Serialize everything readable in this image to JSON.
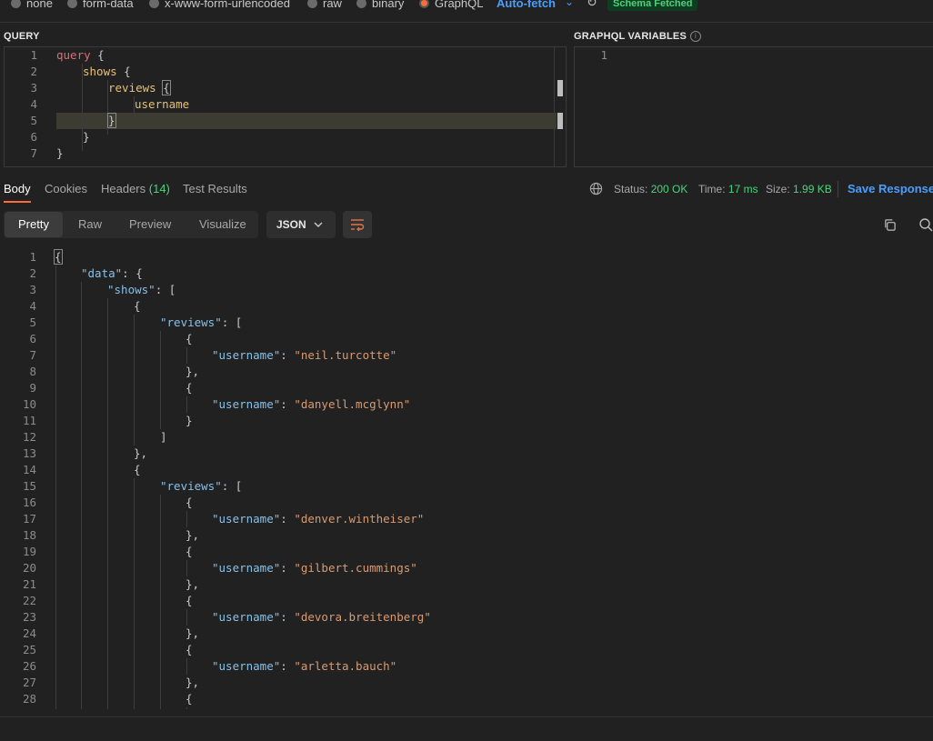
{
  "body_types": [
    {
      "label": "none",
      "selected": false
    },
    {
      "label": "form-data",
      "selected": false
    },
    {
      "label": "x-www-form-urlencoded",
      "selected": false
    },
    {
      "label": "raw",
      "selected": false
    },
    {
      "label": "binary",
      "selected": false
    },
    {
      "label": "GraphQL",
      "selected": true
    }
  ],
  "auto_fetch": "Auto-fetch",
  "schema_status": "Schema Fetched",
  "query_label": "QUERY",
  "variables_label": "GRAPHQL VARIABLES",
  "query_lines": [
    "1",
    "2",
    "3",
    "4",
    "5",
    "6",
    "7"
  ],
  "query": {
    "kw": "query",
    "shows": "shows",
    "reviews": "reviews",
    "username": "username",
    "open": "{",
    "close": "}"
  },
  "variables_lines": [
    "1"
  ],
  "response_tabs": {
    "body": "Body",
    "cookies": "Cookies",
    "headers": "Headers",
    "headers_count": "(14)",
    "tests": "Test Results"
  },
  "response_meta": {
    "status_label": "Status:",
    "status_value": "200 OK",
    "time_label": "Time:",
    "time_value": "17 ms",
    "size_label": "Size:",
    "size_value": "1.99 KB",
    "save": "Save Response"
  },
  "view_modes": [
    "Pretty",
    "Raw",
    "Preview",
    "Visualize"
  ],
  "format": "JSON",
  "response_lines": [
    "1",
    "2",
    "3",
    "4",
    "5",
    "6",
    "7",
    "8",
    "9",
    "10",
    "11",
    "12",
    "13",
    "14",
    "15",
    "16",
    "17",
    "18",
    "19",
    "20",
    "21",
    "22",
    "23",
    "24",
    "25",
    "26",
    "27",
    "28"
  ],
  "response_keys": {
    "data": "\"data\"",
    "shows": "\"shows\"",
    "reviews": "\"reviews\"",
    "username": "\"username\""
  },
  "usernames": [
    "\"neil.turcotte\"",
    "\"danyell.mcglynn\"",
    "\"denver.wintheiser\"",
    "\"gilbert.cummings\"",
    "\"devora.breitenberg\"",
    "\"arletta.bauch\""
  ]
}
